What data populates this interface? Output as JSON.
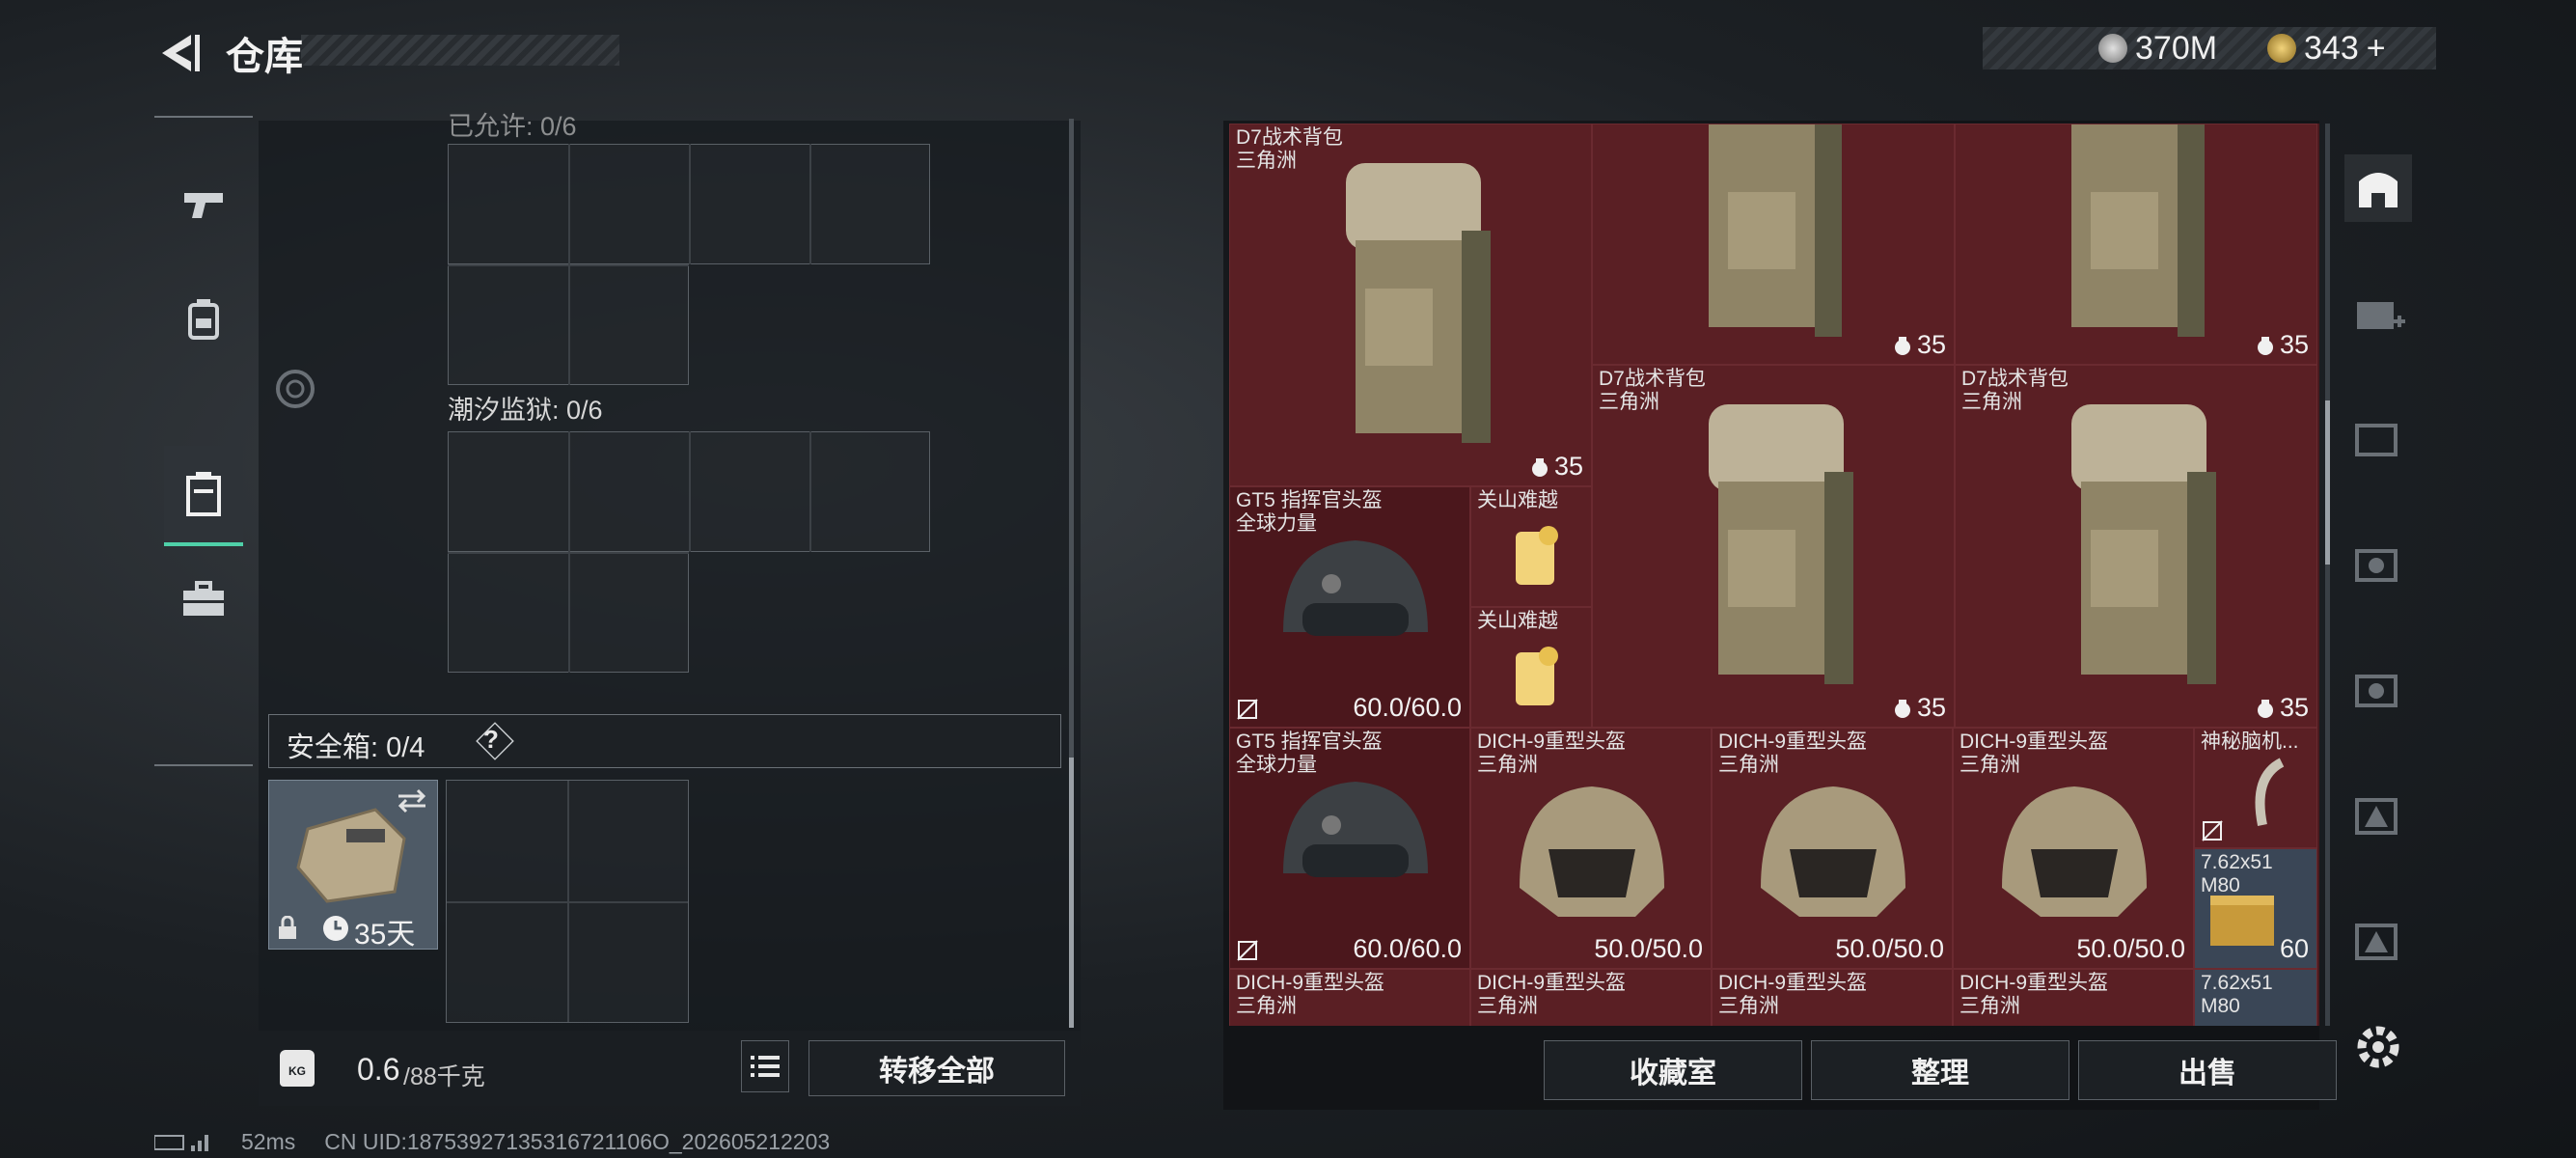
{
  "header": {
    "title": "仓库"
  },
  "currency": {
    "silver": "370M",
    "gold": "343",
    "gold_plus": "+"
  },
  "left": {
    "tidal_prison_label": "潮汐监狱: 0/6",
    "top_partial_label": "已允许: 0/6",
    "safe_box_label": "安全箱: 0/4",
    "help_label": "?",
    "safe_box_days": "35天",
    "weight_value": "0.6",
    "weight_max": "/88千克",
    "weight_icon": "KG",
    "transfer_all": "转移全部"
  },
  "items": {
    "backpack_name": "D7战术背包",
    "backpack_origin": "三角洲",
    "backpack_qty": "35",
    "helmet_gt5_name": "GT5 指挥官头盔",
    "helmet_gt5_origin": "全球力量",
    "helmet_gt5_dur": "60.0/60.0",
    "drink_name": "关山难越",
    "dich_name": "DICH-9重型头盔",
    "dich_origin": "三角洲",
    "dich_dur": "50.0/50.0",
    "mystery_name": "神秘脑机...",
    "ammo_name": "7.62x51 M80",
    "ammo_qty": "60"
  },
  "actions": {
    "collection": "收藏室",
    "organize": "整理",
    "sell": "出售"
  },
  "status": {
    "ping": "52ms",
    "uid": "CN UID:18753927135316721106O_202605212203"
  },
  "colors": {
    "accent": "#4fd0a8",
    "item_bg": "#5a1f24"
  }
}
